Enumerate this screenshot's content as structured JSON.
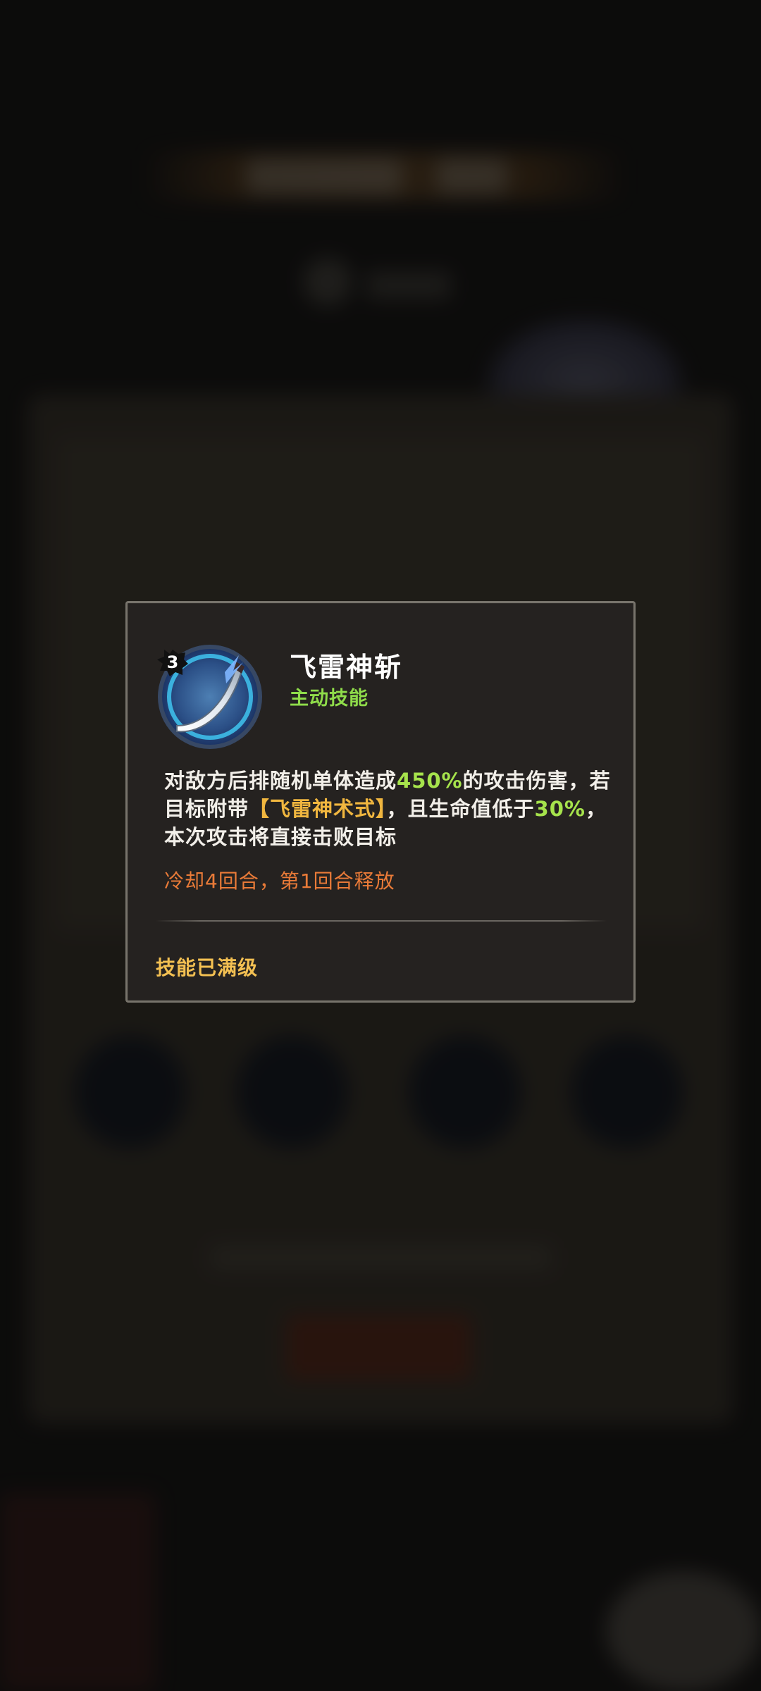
{
  "skill": {
    "level": "3",
    "name": "飞雷神斩",
    "type": "主动技能",
    "icon": "curved-blade-icon",
    "description": {
      "p1": "对敌方后排随机单体造成",
      "damage": "450%",
      "p2": "的攻击伤害，若目标附带",
      "mark": "【飞雷神术式】",
      "p3": "，且生命值低于",
      "threshold": "30%",
      "p4": "，本次攻击将直接击败目标"
    },
    "cooldown": "冷却4回合，第1回合释放",
    "status": "技能已满级"
  },
  "colors": {
    "type_green": "#8fdc4a",
    "value_green": "#a6e34c",
    "mark_gold": "#f0b63f",
    "cooldown_orange": "#ea7b38",
    "status_gold": "#f3c052",
    "frame": "#77736b"
  }
}
